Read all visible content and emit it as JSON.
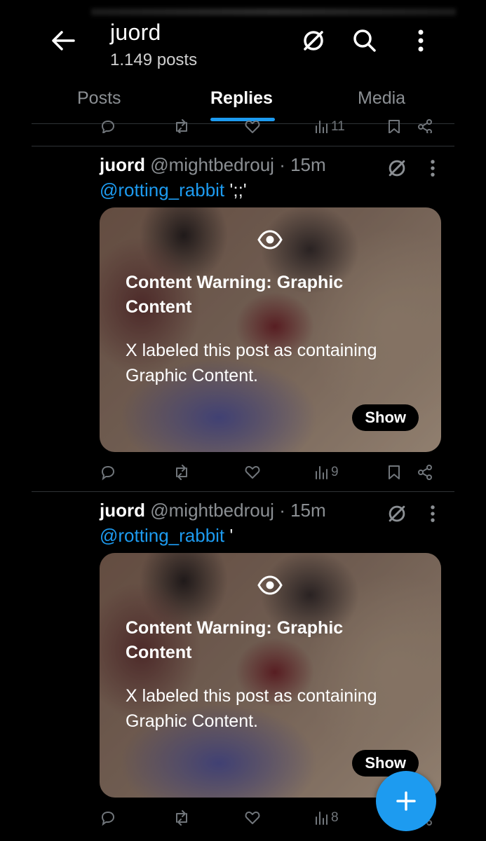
{
  "header": {
    "title": "juord",
    "post_count": "1.149 posts",
    "icons": [
      "back-arrow-icon",
      "grok-icon",
      "search-icon",
      "more-vertical-icon"
    ]
  },
  "tabs": [
    {
      "label": "Posts",
      "active": false
    },
    {
      "label": "Replies",
      "active": true
    },
    {
      "label": "Media",
      "active": false
    }
  ],
  "partial_row": {
    "views": "11"
  },
  "tweets": [
    {
      "name": "juord",
      "handle": "@mightbedrouj",
      "time": "· 15m",
      "mention": "@rotting_rabbit",
      "reply_text": " ';;'",
      "warning_title": "Content Warning: Graphic Content",
      "warning_body": "X labeled this post as containing Graphic Content.",
      "show_label": "Show",
      "views": "9"
    },
    {
      "name": "juord",
      "handle": "@mightbedrouj",
      "time": "· 15m",
      "mention": "@rotting_rabbit",
      "reply_text": " '",
      "warning_title": "Content Warning: Graphic Content",
      "warning_body": "X labeled this post as containing Graphic Content.",
      "show_label": "Show",
      "views": "8"
    }
  ],
  "colors": {
    "accent": "#1d9bf0",
    "background": "#000000",
    "muted": "#71767b"
  }
}
